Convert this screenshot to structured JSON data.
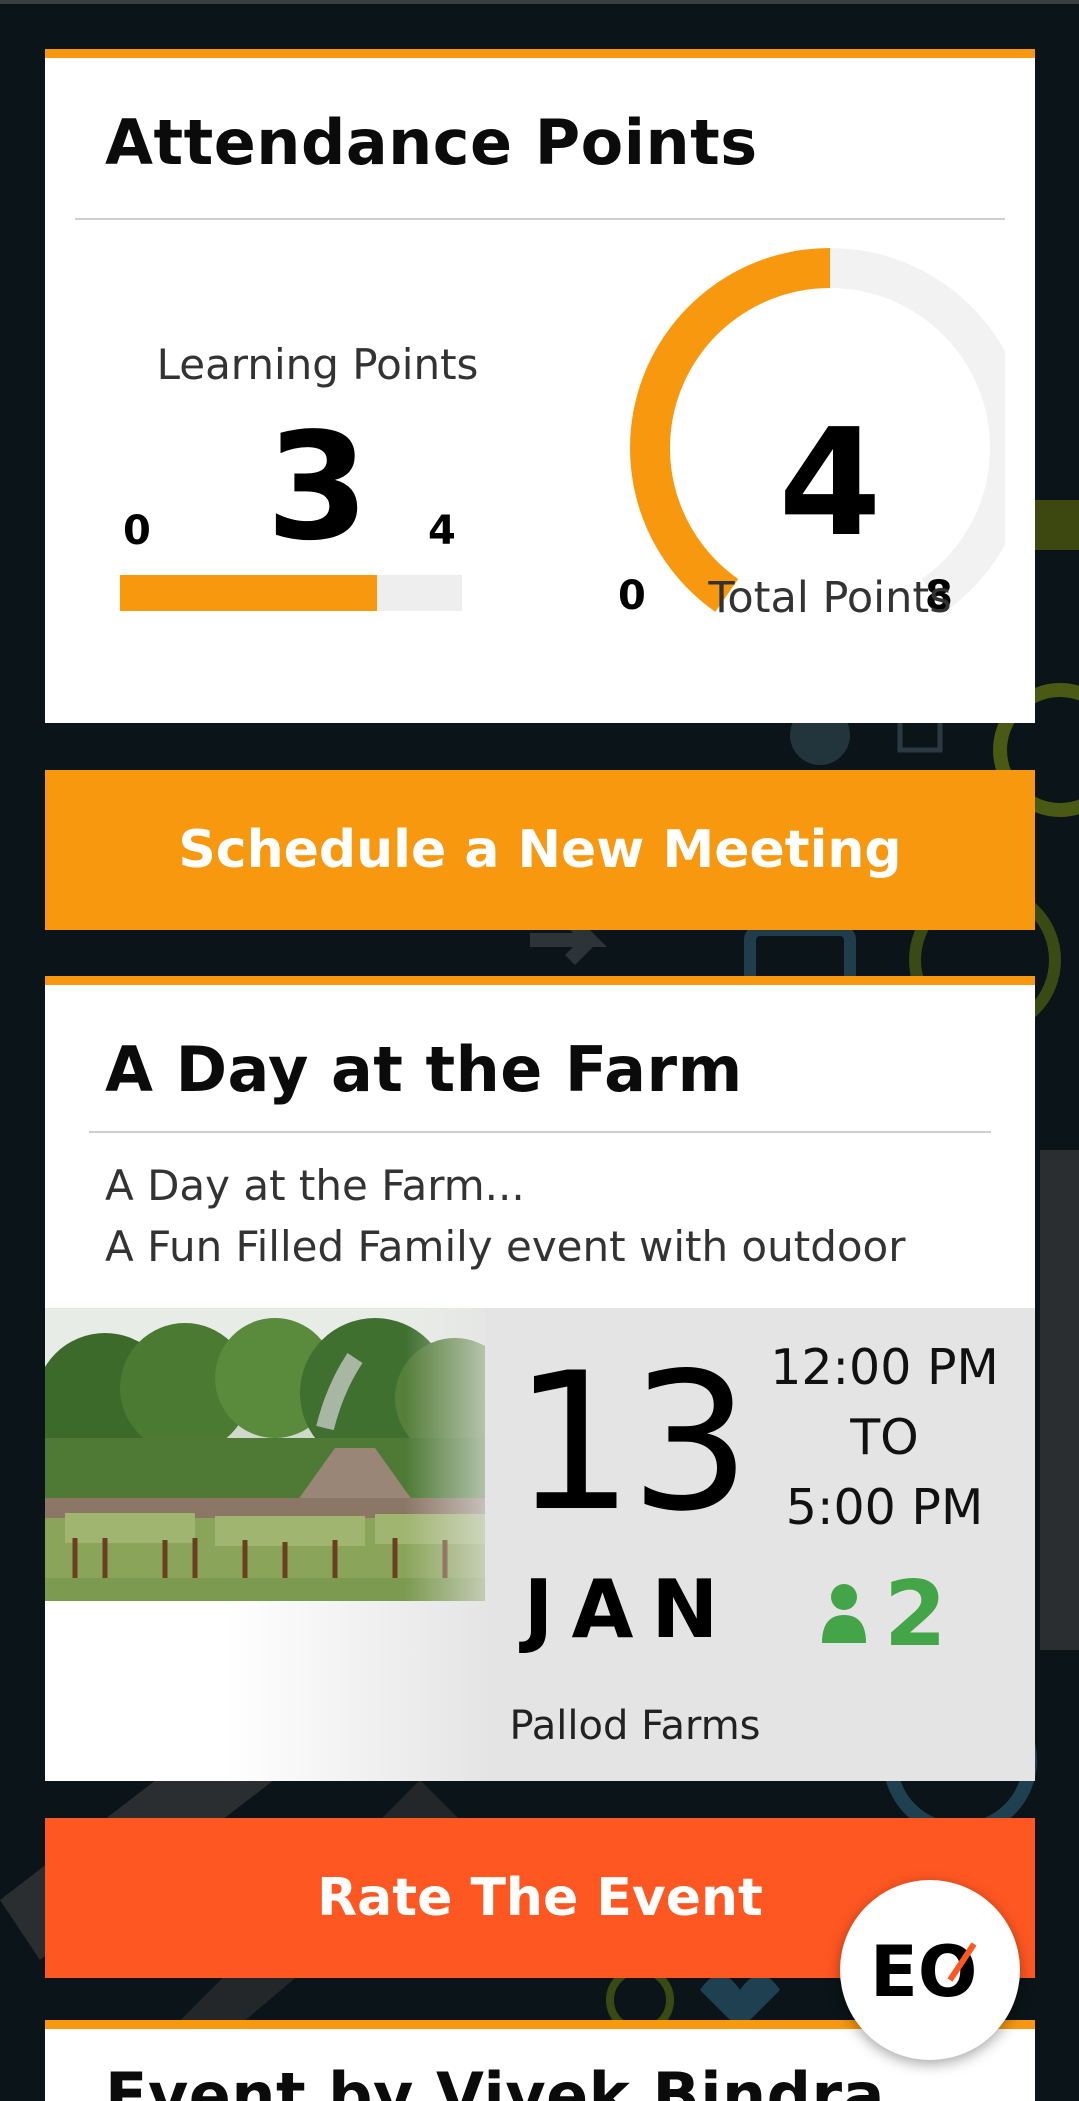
{
  "attendance": {
    "title": "Attendance Points",
    "learning": {
      "label": "Learning Points",
      "value": "3",
      "min": "0",
      "max": "4",
      "fraction": 0.75
    },
    "total": {
      "label": "Total Points",
      "value": "4",
      "min": "0",
      "max": "8",
      "fraction": 0.5
    }
  },
  "schedule_button": "Schedule a New Meeting",
  "event": {
    "title": "A Day at the Farm",
    "description_line1": "A Day at the Farm...",
    "description_line2": "A Fun Filled Family event with outdoor",
    "day": "13",
    "month": "JAN",
    "start_time": "12:00 PM",
    "to": "TO",
    "end_time": "5:00 PM",
    "attendees": "2",
    "venue": "Pallod Farms"
  },
  "rate_button": "Rate The Event",
  "next_card_title": "Event by Vivek Bindra",
  "fab_logo": "EO",
  "colors": {
    "accent": "#f7980f",
    "rate": "#ff5722",
    "attendee": "#43a547"
  },
  "icons": [
    "person-icon",
    "eo-logo-icon"
  ]
}
